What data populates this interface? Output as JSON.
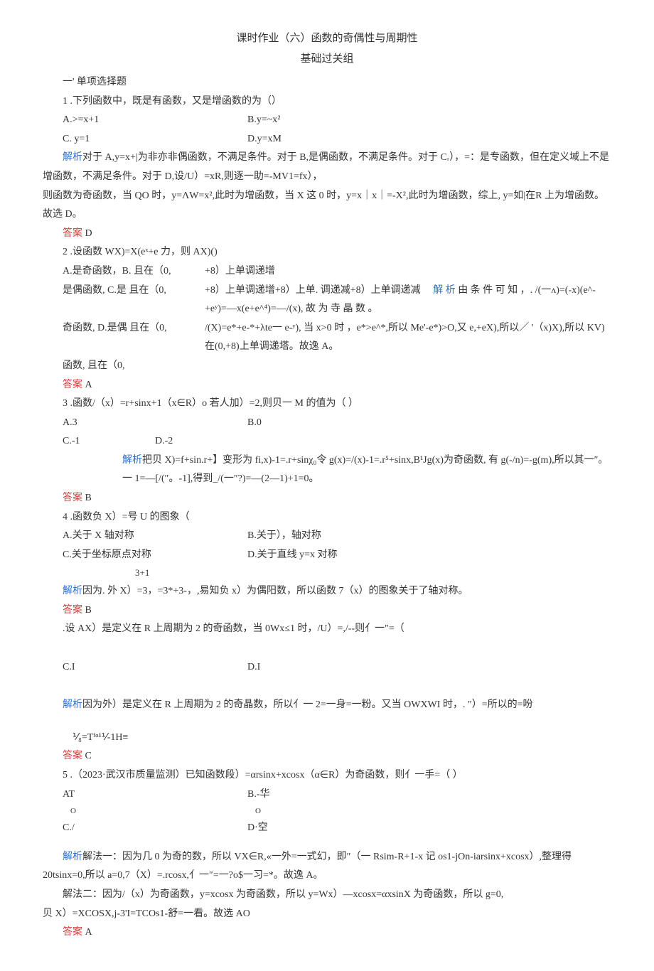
{
  "header": {
    "title": "课时作业（六）函数的奇偶性与周期性",
    "subtitle": "基础过关组"
  },
  "sec1_heading": "一' 单项选择题",
  "q1": {
    "stem": "1 .下列函数中，既是有函数，又是增函数的为（）",
    "optA": "A.>=x+1",
    "optB": "B.y=~x²",
    "optC": "C.   y=1",
    "optD": "D.y=xM",
    "expl_label": "解析",
    "expl_a": "对于 A,y=x+|为非亦非偶函数，不满足条件。对于 B,是偶函数，不满足条件。对于 Cᵣ），=：是专函数，但在定义域上不是增函数，不满足条件。对于 D,设/U）=xR,则逐一助=-MV1=fx），",
    "expl_b": "则函数为奇函数，当 QO 时，y=ΛW=x²,此时为增函数，当 X 这 0 时，y=x｜x｜=-X²,此时为增函数，综上, y=如|在R 上为增函数。故选 D。",
    "ans_label": "答案",
    "ans": "D"
  },
  "q2": {
    "stem": "2 .设函数 WX)=X(eˣ+e 力，则 AX)()",
    "optA_l": "A.是奇函数，B. 且在（0,",
    "optA_r": "+8）上单调递增",
    "optB_l": "是偶函数, C.是 且在（0,",
    "optB_r": "+8）上单调递增+8）上单. 调递减+8）上单调递减",
    "optC_l": "奇函数, D.是偶 且在（0,",
    "optD_l": "函数,          且在（0,",
    "expl_label": "解 析",
    "expl_a": "由 条 件 可 知 ，. /(一ʌ)=(-x)(e^-+eʸ)=—x(e+e^⁴)=—/(x), 故 为 寺 晶 数 。",
    "expl_b": "/(X)=e*+e-*+λte一 e-ʸ), 当 x>0 时 ，e*>e^*,所以 Me'-e*)>O,又 e,+eX),所以／ '（x)X),所以 KV)在(0,+8)上单调递塔。故逸 A。",
    "ans_label": "答案",
    "ans": "A"
  },
  "q3": {
    "stem": "3 .函数/（x）=r+sinx+1（x∈R）o 若人加）=2,则贝一 M 的值为（   ）",
    "optA": "A.3",
    "optB": "B.0",
    "optC": "C.-1",
    "optD": "D.-2",
    "expl_label": "解析",
    "expl": "把贝 X)=f+sin.r+】变形为 fi,x)-1=.r+sinχ₀令 g(x)=/(x)-1=.r⁵+sinx,B¹Jg(x)为奇函数, 有 g(-/n)=-g(m),所以其一″。一 1=—[/(″。-1],得到_/(一″?)=—(2—1)+1=0。",
    "ans_label": "答案",
    "ans": "B"
  },
  "q4": {
    "stem": "4 .函数负 X）=号 U 的图象（",
    "optA": "A.关于 X 轴对称",
    "optB": "B.关于），轴对称",
    "optC": "C.关于坐标原点对称",
    "optD": "D.关于直线 y=x 对称",
    "frac_note": "3+1",
    "expl_label": "解析",
    "expl": "因为. 外 X）=3，=3*+3-，,易知负 x）为偶阳数，所以函数 7（x）的图象关于了轴对称。",
    "ans_label": "答案",
    "ans": "B"
  },
  "q5": {
    "stem": ".设 AX）是定义在 R 上周期为 2 的奇函数，当 0Wx≤1 时，/U）=,/--则亻一″=（",
    "optC": "C.I",
    "optD": "D.I",
    "expl_label": "解析",
    "expl": "因为外）是定义在 R 上周期为 2 的奇晶数，所以亻一 2=一身=一粉。又当 OWXWI 时，. ″）=所以的=吩",
    "extra": "⅟₈=Tᶠᵅ¹⅟-1H≡",
    "ans_label": "答案",
    "ans": "C"
  },
  "q6": {
    "stem": "5 .（2023·武汉市质量监测）已知函数段）=αrsinx+xcosx（α∈R）为奇函数，则亻一手=（ ）",
    "optA": "AT",
    "optA_sub": "O",
    "optB": "B.-华",
    "optB_sub": "O",
    "optC": "C./",
    "optD": "D·空",
    "expl_label": "解析",
    "expl_a": "解法一：因为几 0 为奇的数，所以 VX∈R,«一外=一式幻，即″（一 Rsim-R+1-x 记 os1-jOn-iarsinx+xcosx）,整理得 20tsinx=0,所以 a=0,7（X）=.rcosx,亻一″=一?o$一习=*。故逸 A。",
    "expl_b": "解法二：因为/（x）为奇函数，y=xcosx 为奇函数，所以 y=Wx）—xcosx=αxsinX 为奇函数，所以 g=0,",
    "expl_c": "贝 X）=XCOSX,j-3'I=TCOs1-舒=一看。故选 AO",
    "ans_label": "答案",
    "ans": "A"
  }
}
